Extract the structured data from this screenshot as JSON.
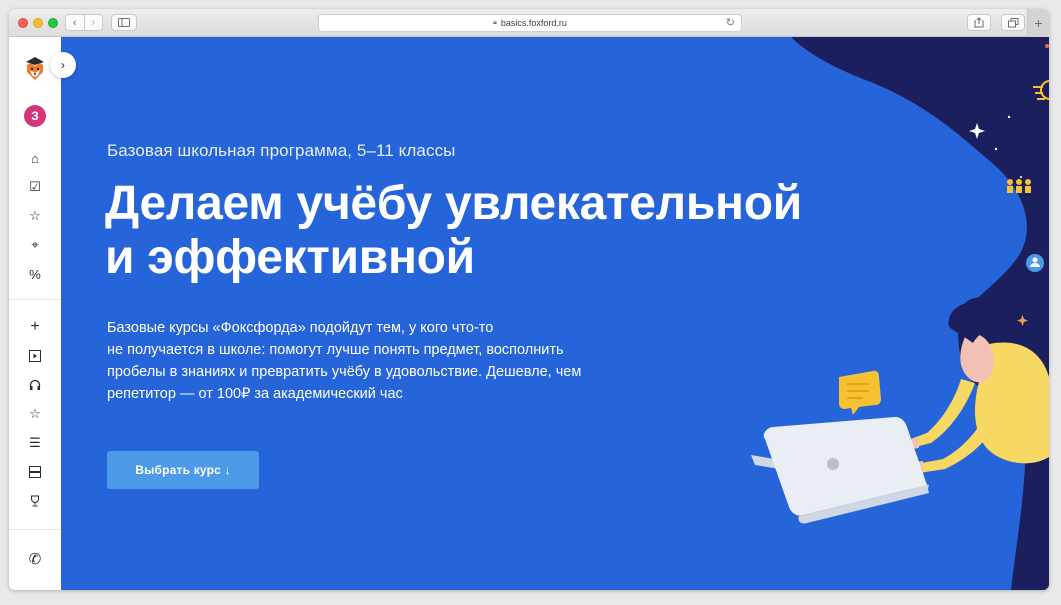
{
  "browser": {
    "url": "basics.foxford.ru",
    "new_tab_label": "+"
  },
  "sidebar": {
    "avatar_letter": "З",
    "items_top": [
      {
        "icon": "home-icon",
        "glyph": "⌂"
      },
      {
        "icon": "checkbox-icon",
        "glyph": "☑"
      },
      {
        "icon": "star-icon",
        "glyph": "☆"
      },
      {
        "icon": "tag-icon",
        "glyph": "⌖"
      },
      {
        "icon": "percent-icon",
        "glyph": "%"
      }
    ],
    "items_bottom": [
      {
        "icon": "plus-icon",
        "glyph": "+"
      },
      {
        "icon": "play-square-icon",
        "glyph": "▸"
      },
      {
        "icon": "headphones-icon",
        "glyph": "∩"
      },
      {
        "icon": "star-outline-icon",
        "glyph": "☆"
      },
      {
        "icon": "list-icon",
        "glyph": "☰"
      },
      {
        "icon": "cards-icon",
        "glyph": "▤"
      },
      {
        "icon": "trophy-icon",
        "glyph": "♕"
      }
    ],
    "phone_glyph": "✆"
  },
  "hero": {
    "subtitle": "Базовая школьная программа, 5–11 классы",
    "title_line1": "Делаем учёбу увлекательной",
    "title_line2": "и эффективной",
    "description_lines": [
      "Базовые курсы «Фоксфорда» подойдут тем, у кого что-то",
      "не получается в школе: помогут лучше понять предмет, восполнить",
      "пробелы в знаниях и превратить учёбу в удовольствие. Дешевле, чем",
      "репетитор — от 100₽ за академический час"
    ],
    "cta_label": "Выбрать курс ↓"
  },
  "colors": {
    "hero_bg": "#2664d9",
    "cta_bg": "#4d9be8",
    "night_bg": "#1b1f5e",
    "accent_yellow": "#f6c232"
  }
}
